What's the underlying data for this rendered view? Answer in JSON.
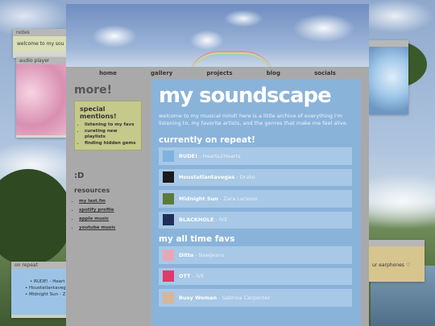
{
  "nav": [
    "home",
    "gallery",
    "projects",
    "blog",
    "socials"
  ],
  "title": "my soundscape",
  "intro": "welcome to my musical mind! here is a little archive of everything i'm listening to, my favorite artists, and the genres that make me feel alive.",
  "sidebar": {
    "heading": "more!",
    "special_title": "special mentions!",
    "special_items": [
      "listening to my favs",
      "curating new playlists",
      "finding hidden gems"
    ],
    "emote": ":D",
    "resources_title": "resources",
    "resources": [
      "my last.fm",
      "spotify profile",
      "apple music",
      "youtube music"
    ]
  },
  "repeat_heading": "currently on repeat!",
  "repeat": [
    {
      "title": "RUDE!",
      "artist": "Hearts2Hearts",
      "color": "#7fb2e0"
    },
    {
      "title": "Houstatlantavegas",
      "artist": "Drake",
      "color": "#1a1a1a"
    },
    {
      "title": "Midnight Sun",
      "artist": "Zara Larsson",
      "color": "#5c7a3a"
    },
    {
      "title": "BLACKHOLE",
      "artist": "IVE",
      "color": "#1f2f5a"
    }
  ],
  "favs_heading": "my all time favs",
  "favs": [
    {
      "title": "Ditto",
      "artist": "NewJeans",
      "color": "#e6a8b8"
    },
    {
      "title": "OTT",
      "artist": "IVE",
      "color": "#e03a6a"
    },
    {
      "title": "Busy Woman",
      "artist": "Sabrina Carpenter",
      "color": "#d9b59a"
    }
  ],
  "windows": {
    "notes_title": "notes",
    "notes_text": "welcome to my sou",
    "player_title": "audio player",
    "onrepeat_title": "on repeat",
    "onrepeat_items": [
      "RUDE! - Heart",
      "Houstatlantaveg",
      "Midnight Sun - Z"
    ],
    "earphones_text": "ur earphones ♡"
  },
  "song_sep": " - "
}
